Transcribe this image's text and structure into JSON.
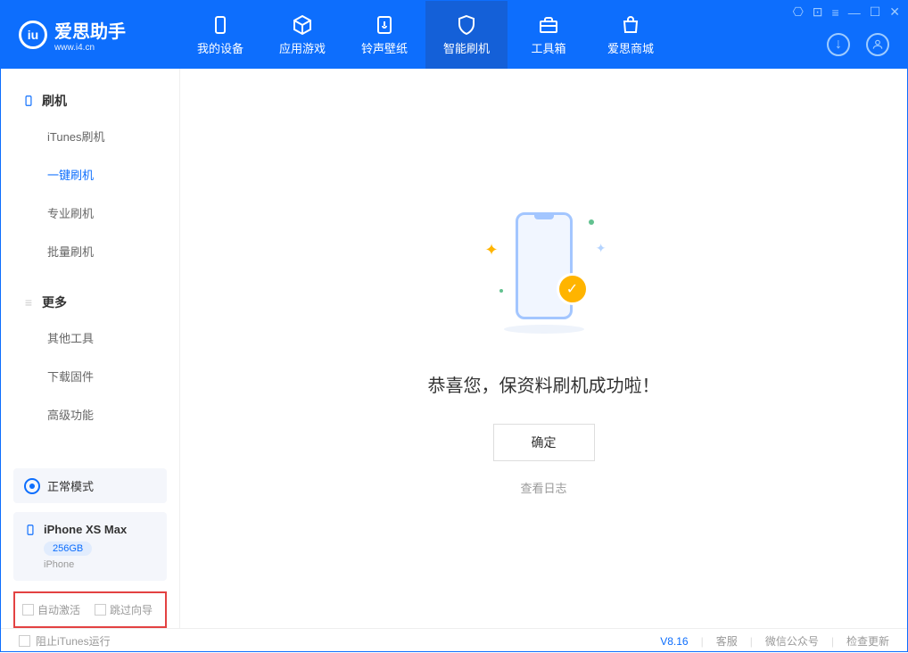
{
  "app": {
    "name": "爱思助手",
    "url": "www.i4.cn"
  },
  "nav": [
    {
      "label": "我的设备",
      "icon": "device"
    },
    {
      "label": "应用游戏",
      "icon": "cube"
    },
    {
      "label": "铃声壁纸",
      "icon": "music"
    },
    {
      "label": "智能刷机",
      "icon": "shield",
      "active": true
    },
    {
      "label": "工具箱",
      "icon": "toolbox"
    },
    {
      "label": "爱思商城",
      "icon": "bag"
    }
  ],
  "sidebar": {
    "flash_heading": "刷机",
    "flash_items": [
      "iTunes刷机",
      "一键刷机",
      "专业刷机",
      "批量刷机"
    ],
    "flash_active_index": 1,
    "more_heading": "更多",
    "more_items": [
      "其他工具",
      "下载固件",
      "高级功能"
    ]
  },
  "mode": {
    "label": "正常模式"
  },
  "device": {
    "name": "iPhone XS Max",
    "storage": "256GB",
    "type": "iPhone"
  },
  "checkboxes": {
    "auto_activate": "自动激活",
    "skip_guide": "跳过向导"
  },
  "main": {
    "success_msg": "恭喜您，保资料刷机成功啦！",
    "ok_label": "确定",
    "log_link": "查看日志"
  },
  "footer": {
    "block_itunes": "阻止iTunes运行",
    "version": "V8.16",
    "links": [
      "客服",
      "微信公众号",
      "检查更新"
    ]
  }
}
